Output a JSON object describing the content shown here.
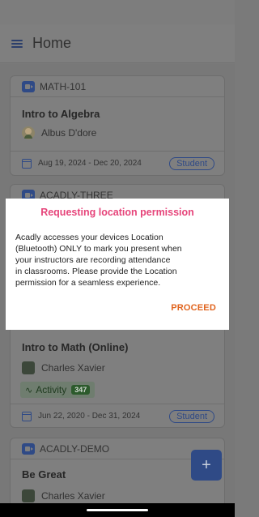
{
  "app": {
    "title": "Home"
  },
  "colors": {
    "accent": "#2f4a86",
    "dialog_title": "#e6447a",
    "proceed": "#e0641e",
    "activity": "#2c5a2c"
  },
  "cards": [
    {
      "code": "MATH-101",
      "title": "Intro to Algebra",
      "person": "Albus D'dore",
      "dates": "Aug 19, 2024 - Dec 20, 2024",
      "role": "Student"
    },
    {
      "code": "ACADLY-THREE",
      "title": "Intro to Math (Online)",
      "person": "Charles Xavier",
      "activity_label": "Activity",
      "activity_count": "347",
      "dates": "Jun 22, 2020 - Dec 31, 2024",
      "role": "Student"
    },
    {
      "code": "ACADLY-DEMO",
      "title": "Be Great",
      "person": "Charles Xavier"
    }
  ],
  "dialog": {
    "title": "Requesting location permission",
    "line1": "Acadly accesses your devices Location",
    "line2": "(Bluetooth) ONLY to mark you present when",
    "line3": "your instructors are recording attendance",
    "line4": "in classrooms. Please provide the Location",
    "line5": "permission for a seamless experience.",
    "proceed_label": "PROCEED"
  },
  "fab": {
    "label": "+"
  },
  "icons": {
    "menu": "menu-icon",
    "camera": "video-camera-icon",
    "calendar": "calendar-icon",
    "activity": "pulse-icon",
    "add": "plus-icon"
  }
}
